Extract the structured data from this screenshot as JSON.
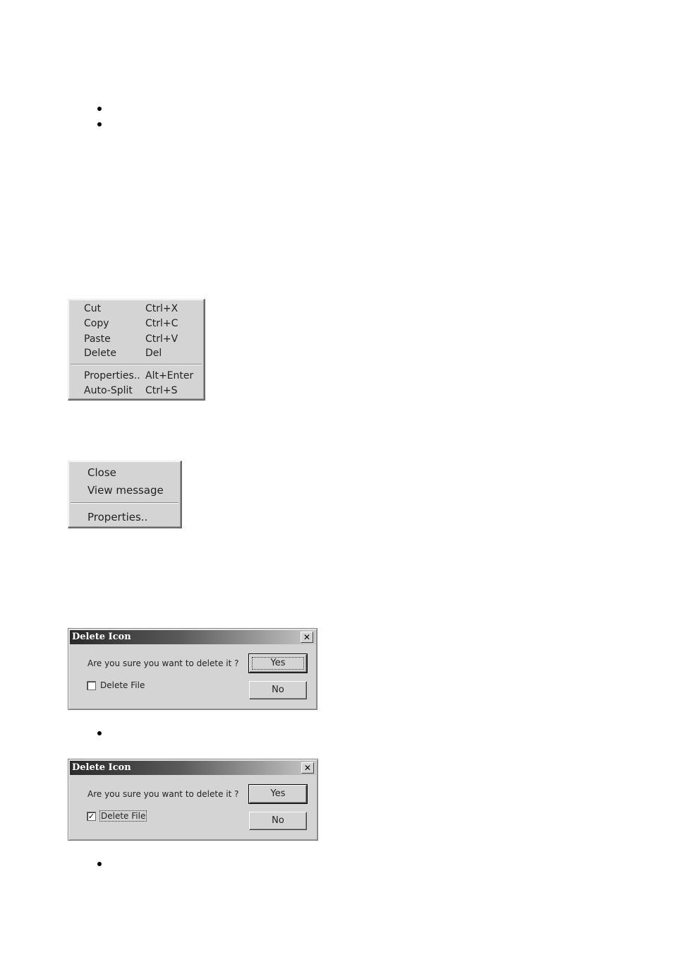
{
  "edit_menu": {
    "items": [
      {
        "label": "Cut",
        "shortcut": "Ctrl+X"
      },
      {
        "label": "Copy",
        "shortcut": "Ctrl+C"
      },
      {
        "label": "Paste",
        "shortcut": "Ctrl+V"
      },
      {
        "label": "Delete",
        "shortcut": "Del"
      },
      {
        "label": "Properties..",
        "shortcut": "Alt+Enter"
      },
      {
        "label": "Auto-Split",
        "shortcut": "Ctrl+S"
      }
    ]
  },
  "message_menu": {
    "items": [
      {
        "label": "Close"
      },
      {
        "label": "View message"
      },
      {
        "label": "Properties.."
      }
    ]
  },
  "dialog_unchecked": {
    "title": "Delete Icon",
    "close_glyph": "✕",
    "question": "Are you sure you want to delete it ?",
    "checkbox_label": "Delete File",
    "checkbox_checked": false,
    "yes_label": "Yes",
    "no_label": "No"
  },
  "dialog_checked": {
    "title": "Delete Icon",
    "close_glyph": "✕",
    "question": "Are you sure you want to delete it ?",
    "checkbox_label": "Delete File",
    "checkbox_checked": true,
    "check_glyph": "✓",
    "yes_label": "Yes",
    "no_label": "No"
  }
}
